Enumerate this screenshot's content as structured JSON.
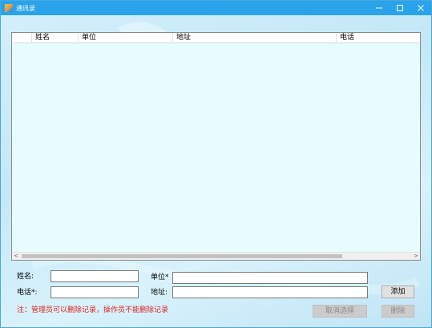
{
  "window": {
    "title": "通讯录",
    "minimize_glyph": "–",
    "maximize_glyph": "□",
    "close_glyph": "✕"
  },
  "table": {
    "columns": [
      "姓名",
      "单位",
      "地址",
      "电话"
    ],
    "rows": [],
    "scroll_left_glyph": "<",
    "scroll_right_glyph": ">"
  },
  "form": {
    "name_label": "姓名:",
    "name_value": "",
    "unit_label": "单位*",
    "unit_value": "",
    "phone_label": "电话*:",
    "phone_value": "",
    "address_label": "地址:",
    "address_value": ""
  },
  "buttons": {
    "add_label": "添加",
    "cancel_selection_label": "取消选择",
    "delete_label": "删除"
  },
  "note": "注：管理员可以删除记录，操作员不能删除记录",
  "colors": {
    "titlebar": "#2aa3ea",
    "list_background": "#e6fcfd",
    "note_text": "#e0211f"
  }
}
